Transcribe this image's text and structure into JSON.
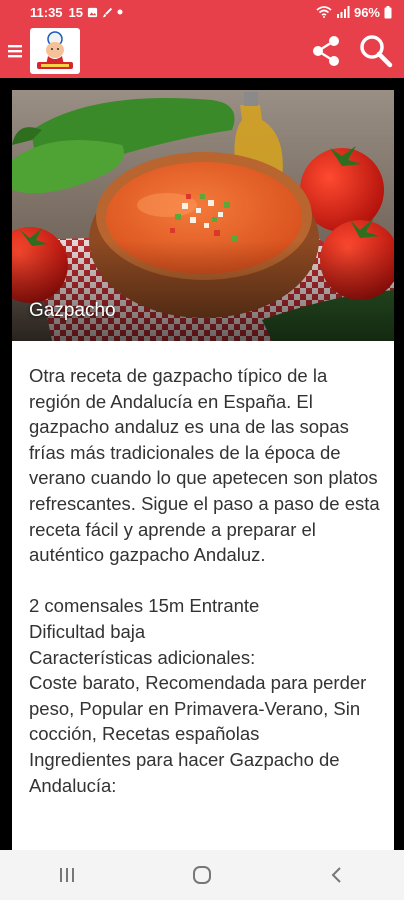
{
  "status_bar": {
    "time": "11:35",
    "day": "15",
    "battery": "96%"
  },
  "recipe": {
    "title": "Gazpacho",
    "description": "Otra receta de gazpacho típico de la región de Andalucía en España. El gazpacho andaluz es una de las sopas frías más tradicionales de la época de verano cuando lo que apetecen son platos refrescantes. Sigue el paso a paso de esta receta fácil y aprende a preparar el auténtico gazpacho Andaluz.",
    "meta": "2 comensales 15m Entrante",
    "difficulty": "Dificultad baja",
    "extras_heading": "Características adicionales:",
    "extras": "Coste barato, Recomendada para perder peso, Popular en Primavera-Verano, Sin cocción, Recetas españolas",
    "ingredients_heading": "Ingredientes para hacer Gazpacho de Andalucía:"
  },
  "colors": {
    "accent": "#e8404a",
    "background": "#000000",
    "card": "#ffffff"
  },
  "icons": {
    "menu": "hamburger-icon",
    "share": "share-icon",
    "search": "search-icon",
    "recents": "recents-icon",
    "home": "home-icon",
    "back": "back-icon"
  }
}
